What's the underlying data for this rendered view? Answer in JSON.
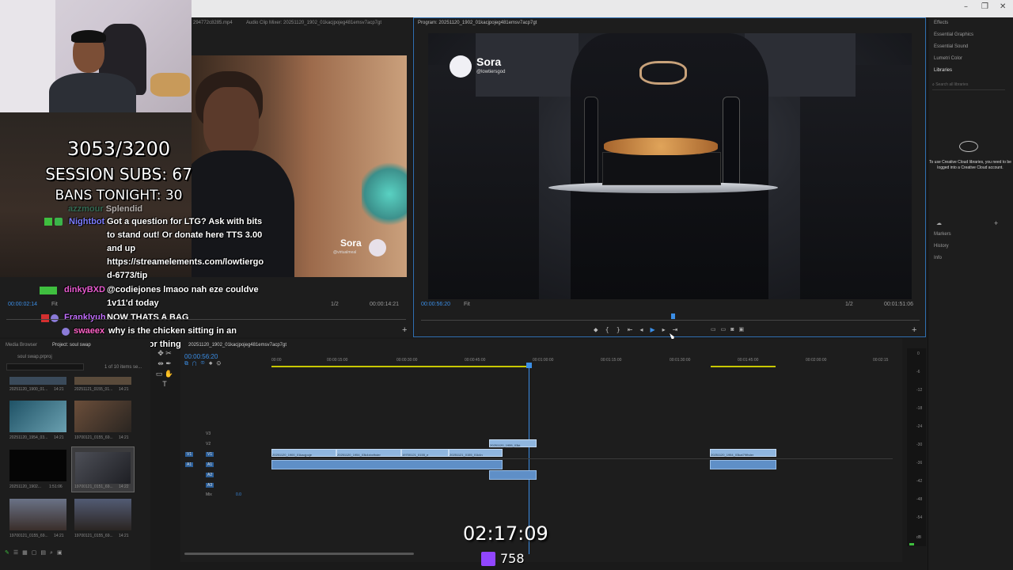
{
  "window": {
    "minimize": "–",
    "maximize": "❐",
    "close": "✕"
  },
  "source_monitor": {
    "tab_source": "294772c8285.mp4",
    "tab_audio": "Audio Clip Mixer: 20251120_1902_01kacjpojeg481emsv7acp7gt",
    "timecode": "00:00:02:14",
    "fit": "Fit",
    "fraction": "1/2",
    "duration": "00:00:14:21",
    "watermark_name": "Sora",
    "watermark_handle": "@virtualmeal"
  },
  "stream_overlay": {
    "sub_goal": "3053/3200",
    "session_subs": "SESSION SUBS: 67",
    "bans": "BANS TONIGHT: 30",
    "stream_time": "02:17:09",
    "viewers": "758"
  },
  "chat": [
    {
      "user": "azzmour",
      "message": "Splendid",
      "color": "#2d8f6e"
    },
    {
      "user": "Nightbot",
      "message": "Got a question for LTG? Ask with bits to stand out! Or donate here TTS 3.00 and up https://streamelements.com/lowtiergo d-6773/tip",
      "color": "#7c7cff"
    },
    {
      "user": "dinkyBXD",
      "message": "@codiejones lmaoo nah eze couldve 1v11'd today",
      "color": "#e85bd0"
    },
    {
      "user": "Franklyuh",
      "message": "NOW THATS A BAG",
      "color": "#c46fff"
    },
    {
      "user": "swaeex",
      "message": "why is the chicken sitting in an underarmor thing",
      "color": "#ff62c7"
    }
  ],
  "program_monitor": {
    "title": "Program: 20251120_1902_01kacjpojeg481emsv7acp7gt",
    "timecode": "00:00:56:20",
    "fit": "Fit",
    "fraction": "1/2",
    "duration": "00:01:51:06",
    "watermark_name": "Sora",
    "watermark_handle": "@lowtiersgod"
  },
  "right_panel": {
    "items": [
      "Effects",
      "Essential Graphics",
      "Essential Sound",
      "Lumetri Color",
      "Libraries"
    ],
    "search_placeholder": "Search all libraries",
    "cc_message": "To use Creative Cloud libraries, you need to be logged into a Creative Cloud account.",
    "bottom_items": [
      "Markers",
      "History",
      "Info"
    ]
  },
  "project": {
    "tab_media": "Media Browser",
    "tab_project": "Project: soul swap",
    "file": "soul swap.prproj",
    "count": "1 of 10 items se...",
    "thumbs": [
      {
        "name": "20251120_1900_01...",
        "dur": "14:21"
      },
      {
        "name": "20251121_0155_01...",
        "dur": "14:21"
      },
      {
        "name": "20251120_1954_03...",
        "dur": "14:21"
      },
      {
        "name": "19700121_0155_69...",
        "dur": "14:21"
      },
      {
        "name": "20251120_1902...",
        "dur": "1:51:06"
      },
      {
        "name": "19700121_0151_69...",
        "dur": "14:22"
      },
      {
        "name": "19700121_0155_69...",
        "dur": "14:21"
      },
      {
        "name": "19700121_0155_69...",
        "dur": "14:21"
      }
    ]
  },
  "timeline": {
    "tab": "20251120_1902_01kacjpojeg481emsv7acp7gt",
    "timecode": "00:00:56:20",
    "ruler": [
      "00:00",
      "00:00:15:00",
      "00:00:30:00",
      "00:00:45:00",
      "00:01:00:00",
      "00:01:15:00",
      "00:01:30:00",
      "00:01:45:00",
      "00:02:00:00",
      "00:02:15"
    ],
    "tracks": [
      "V3",
      "V2",
      "V1",
      "A1",
      "A2",
      "A3",
      "Mix"
    ],
    "mix_value": "0.0",
    "clips": [
      "20251120_1900_01kacjpoje",
      "20251120_1954_03k4xbxfhder",
      "19700121_0155_e",
      "20251121_0155_01k4n",
      "20251120_1955_03kt",
      "20251120_1954_03kat79fhder"
    ]
  },
  "meter_labels": [
    "0",
    "-6",
    "-12",
    "-18",
    "-24",
    "-30",
    "-36",
    "-42",
    "-48",
    "-54",
    "dB"
  ]
}
